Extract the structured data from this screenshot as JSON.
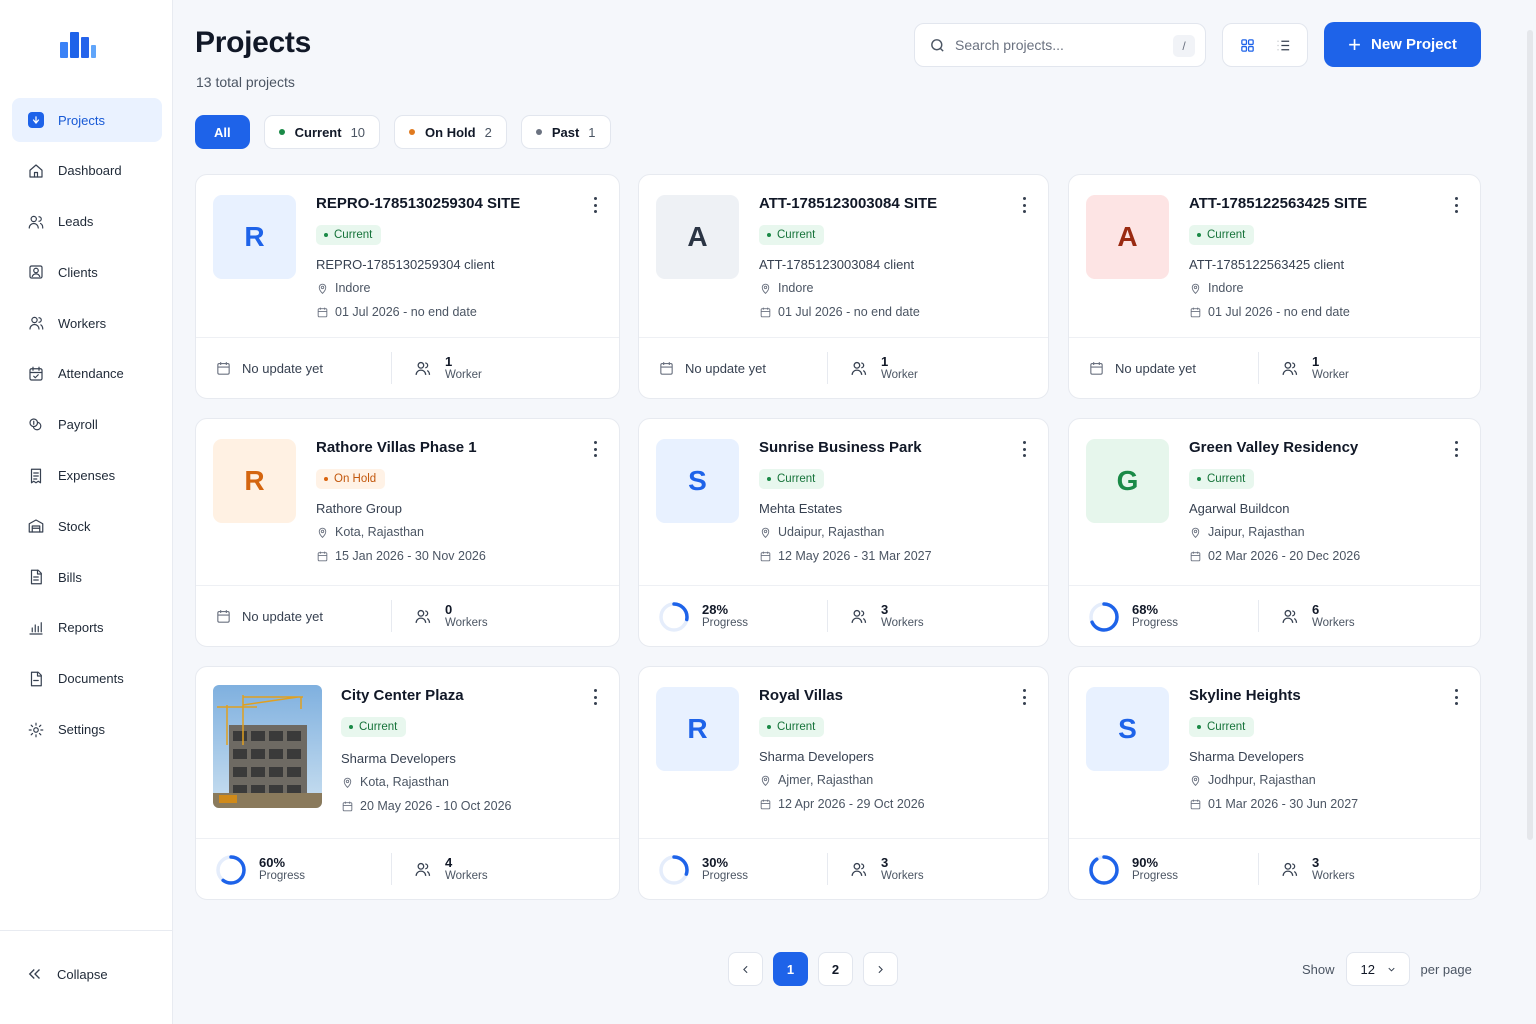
{
  "sidebar": {
    "items": [
      {
        "label": "Projects",
        "icon": "projects-icon",
        "active": true
      },
      {
        "label": "Dashboard",
        "icon": "home-icon"
      },
      {
        "label": "Leads",
        "icon": "users-icon"
      },
      {
        "label": "Clients",
        "icon": "contact-icon"
      },
      {
        "label": "Workers",
        "icon": "user-group-icon"
      },
      {
        "label": "Attendance",
        "icon": "calendar-check-icon"
      },
      {
        "label": "Payroll",
        "icon": "coins-icon"
      },
      {
        "label": "Expenses",
        "icon": "receipt-icon"
      },
      {
        "label": "Stock",
        "icon": "warehouse-icon"
      },
      {
        "label": "Bills",
        "icon": "file-text-icon"
      },
      {
        "label": "Reports",
        "icon": "bar-chart-icon"
      },
      {
        "label": "Documents",
        "icon": "document-icon"
      },
      {
        "label": "Settings",
        "icon": "gear-icon"
      }
    ],
    "collapse_label": "Collapse"
  },
  "header": {
    "title": "Projects",
    "subtitle": "13 total projects",
    "search_placeholder": "Search projects...",
    "search_shortcut": "/",
    "new_button": "New Project"
  },
  "filters": [
    {
      "label": "All",
      "count": "",
      "active": true
    },
    {
      "label": "Current",
      "count": "10",
      "dot": "#1a8a47"
    },
    {
      "label": "On Hold",
      "count": "2",
      "dot": "#e07a1f"
    },
    {
      "label": "Past",
      "count": "1",
      "dot": "#6b7280"
    }
  ],
  "colors": {
    "accent": "#1e63e9",
    "current": "#1a8a47",
    "hold": "#d9640f"
  },
  "projects": [
    {
      "name": "REPRO-1785130259304 SITE",
      "initial": "R",
      "avatar_bg": "#e8f1ff",
      "avatar_fg": "#1e63e9",
      "status": "Current",
      "client": "REPRO-1785130259304 client",
      "location": "Indore",
      "dates": "01 Jul 2026 - no end date",
      "footer_left": "No update yet",
      "workers_num": "1",
      "workers_label": "Worker"
    },
    {
      "name": "ATT-1785123003084 SITE",
      "initial": "A",
      "avatar_bg": "#eef1f5",
      "avatar_fg": "#2b3544",
      "status": "Current",
      "client": "ATT-1785123003084 client",
      "location": "Indore",
      "dates": "01 Jul 2026 - no end date",
      "footer_left": "No update yet",
      "workers_num": "1",
      "workers_label": "Worker"
    },
    {
      "name": "ATT-1785122563425 SITE",
      "initial": "A",
      "avatar_bg": "#fde4e4",
      "avatar_fg": "#9a2a12",
      "status": "Current",
      "client": "ATT-1785122563425 client",
      "location": "Indore",
      "dates": "01 Jul 2026 - no end date",
      "footer_left": "No update yet",
      "workers_num": "1",
      "workers_label": "Worker"
    },
    {
      "name": "Rathore Villas Phase 1",
      "initial": "R",
      "avatar_bg": "#fff1e3",
      "avatar_fg": "#d4650f",
      "status": "On Hold",
      "client": "Rathore Group",
      "location": "Kota, Rajasthan",
      "dates": "15 Jan 2026 - 30 Nov 2026",
      "footer_left": "No update yet",
      "workers_num": "0",
      "workers_label": "Workers"
    },
    {
      "name": "Sunrise Business Park",
      "initial": "S",
      "avatar_bg": "#e8f1ff",
      "avatar_fg": "#1e63e9",
      "status": "Current",
      "client": "Mehta Estates",
      "location": "Udaipur, Rajasthan",
      "dates": "12 May 2026 - 31 Mar 2027",
      "progress": 28,
      "progress_text": "28%",
      "progress_label": "Progress",
      "workers_num": "3",
      "workers_label": "Workers"
    },
    {
      "name": "Green Valley Residency",
      "initial": "G",
      "avatar_bg": "#e6f6ec",
      "avatar_fg": "#1a8a47",
      "status": "Current",
      "client": "Agarwal Buildcon",
      "location": "Jaipur, Rajasthan",
      "dates": "02 Mar 2026 - 20 Dec 2026",
      "progress": 68,
      "progress_text": "68%",
      "progress_label": "Progress",
      "workers_num": "6",
      "workers_label": "Workers"
    },
    {
      "name": "City Center Plaza",
      "photo": true,
      "status": "Current",
      "client": "Sharma Developers",
      "location": "Kota, Rajasthan",
      "dates": "20 May 2026 - 10 Oct 2026",
      "progress": 60,
      "progress_text": "60%",
      "progress_label": "Progress",
      "workers_num": "4",
      "workers_label": "Workers"
    },
    {
      "name": "Royal Villas",
      "initial": "R",
      "avatar_bg": "#e8f1ff",
      "avatar_fg": "#1e63e9",
      "status": "Current",
      "client": "Sharma Developers",
      "location": "Ajmer, Rajasthan",
      "dates": "12 Apr 2026 - 29 Oct 2026",
      "progress": 30,
      "progress_text": "30%",
      "progress_label": "Progress",
      "workers_num": "3",
      "workers_label": "Workers"
    },
    {
      "name": "Skyline Heights",
      "initial": "S",
      "avatar_bg": "#e8f1ff",
      "avatar_fg": "#1e63e9",
      "status": "Current",
      "client": "Sharma Developers",
      "location": "Jodhpur, Rajasthan",
      "dates": "01 Mar 2026 - 30 Jun 2027",
      "progress": 90,
      "progress_text": "90%",
      "progress_label": "Progress",
      "workers_num": "3",
      "workers_label": "Workers"
    }
  ],
  "pagination": {
    "pages": [
      "1",
      "2"
    ],
    "current": "1"
  },
  "per_page": {
    "show_label": "Show",
    "value": "12",
    "suffix": "per page"
  }
}
